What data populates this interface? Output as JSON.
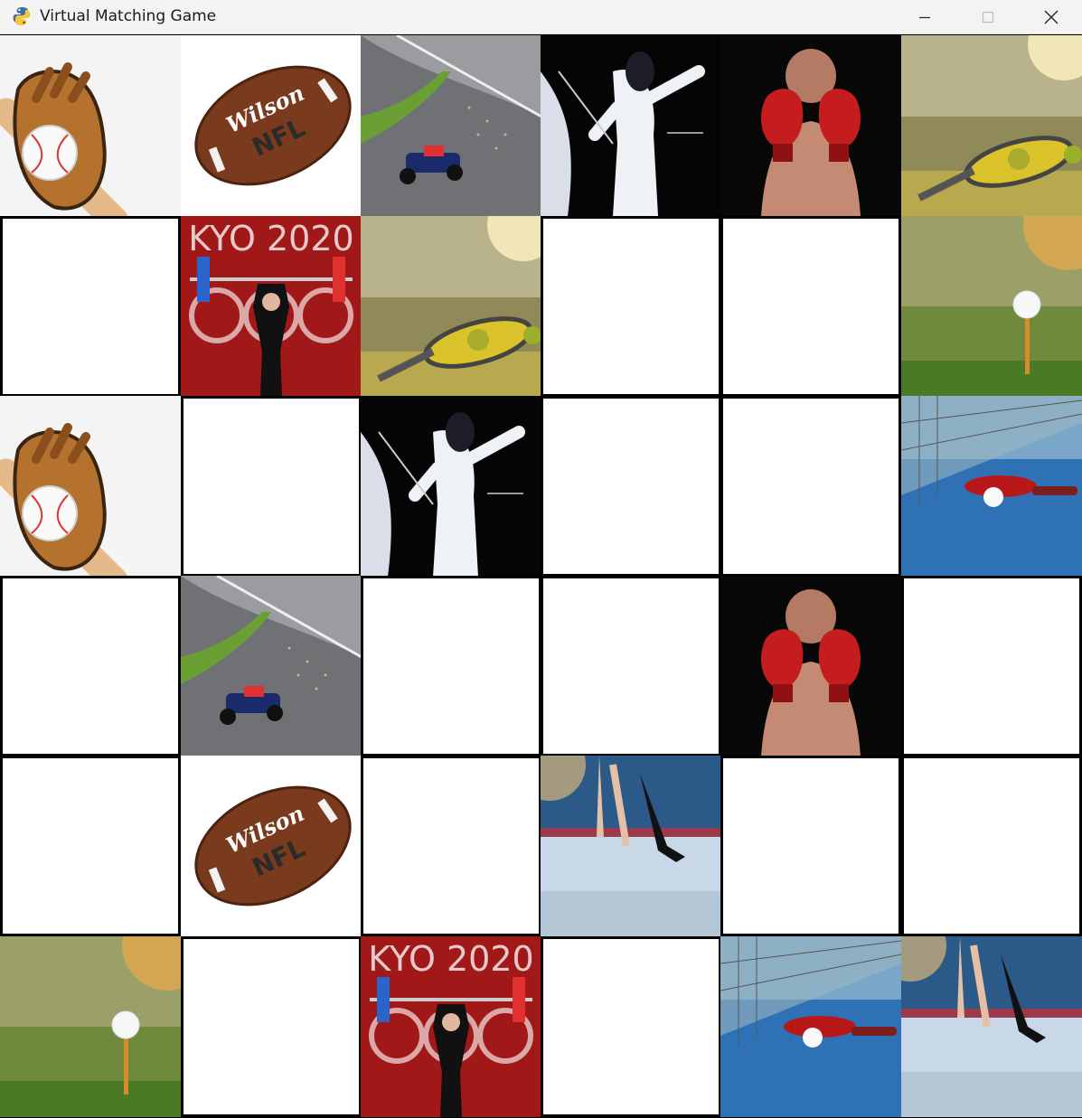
{
  "window": {
    "title": "Virtual Matching Game",
    "app_icon": "python-snake-icon",
    "controls": [
      "minimize-icon",
      "maximize-icon",
      "close-icon"
    ]
  },
  "board": {
    "rows": 6,
    "cols": 6,
    "tiles": [
      [
        "baseball",
        "football",
        "racing",
        "fencing",
        "boxing",
        "tennis"
      ],
      [
        "hidden",
        "weightlifting",
        "tennis",
        "hidden",
        "hidden",
        "golf"
      ],
      [
        "baseball",
        "hidden",
        "fencing",
        "hidden",
        "hidden",
        "table-tennis"
      ],
      [
        "hidden",
        "racing",
        "hidden",
        "hidden",
        "boxing",
        "hidden"
      ],
      [
        "hidden",
        "football",
        "hidden",
        "hockey",
        "hidden",
        "hidden"
      ],
      [
        "golf",
        "hidden",
        "weightlifting",
        "hidden",
        "table-tennis",
        "hockey"
      ]
    ]
  },
  "card_text": {
    "football_brand": "Wilson",
    "football_league": "NFL",
    "weightlifting_banner": "KYO 2020"
  }
}
